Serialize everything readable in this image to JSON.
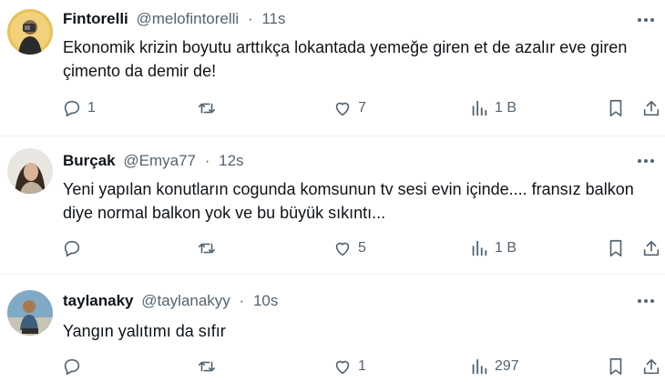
{
  "tweets": [
    {
      "display_name": "Fintorelli",
      "handle": "@melofintorelli",
      "separator": "·",
      "time": "11s",
      "text": "Ekonomik krizin boyutu arttıkça lokantada yemeğe giren et de azalır eve giren çimento da demir de!",
      "replies": "1",
      "retweets": "",
      "likes": "7",
      "views": "1 B"
    },
    {
      "display_name": "Burçak",
      "handle": "@Emya77",
      "separator": "·",
      "time": "12s",
      "text": "Yeni yapılan konutların cogunda komsunun tv sesi evin içinde.... fransız balkon diye normal balkon yok ve bu büyük sıkıntı...",
      "replies": "",
      "retweets": "",
      "likes": "5",
      "views": "1 B"
    },
    {
      "display_name": "taylanaky",
      "handle": "@taylanakyy",
      "separator": "·",
      "time": "10s",
      "text": "Yangın yalıtımı da sıfır",
      "replies": "",
      "retweets": "",
      "likes": "1",
      "views": "297"
    }
  ],
  "colors": {
    "text_primary": "#0f1419",
    "text_secondary": "#536471",
    "divider": "#eff3f4"
  },
  "icons": [
    "more-icon",
    "reply-icon",
    "retweet-icon",
    "like-icon",
    "views-icon",
    "bookmark-icon",
    "share-icon"
  ]
}
